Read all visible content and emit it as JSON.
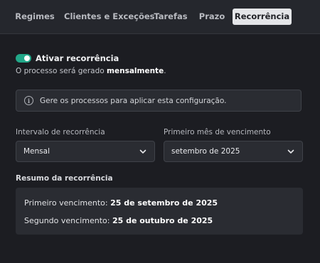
{
  "tabs": [
    {
      "label": "Regimes",
      "active": false
    },
    {
      "label": "Clientes e Exceções",
      "active": false
    },
    {
      "label": "Tarefas",
      "active": false
    },
    {
      "label": "Prazo",
      "active": false
    },
    {
      "label": "Recorrência",
      "active": true
    }
  ],
  "toggle": {
    "label": "Ativar recorrência",
    "on": true
  },
  "frequency_text": {
    "prefix": "O processo será gerado ",
    "value": "mensalmente",
    "suffix": "."
  },
  "info": {
    "text": "Gere os processos para aplicar esta configuração."
  },
  "fields": {
    "interval": {
      "label": "Intervalo de recorrência",
      "value": "Mensal"
    },
    "first_month": {
      "label": "Primeiro mês de vencimento",
      "value": "setembro de 2025"
    }
  },
  "summary": {
    "title": "Resumo da recorrência",
    "first": {
      "label": "Primeiro vencimento: ",
      "value": "25 de setembro de 2025"
    },
    "second": {
      "label": "Segundo vencimento: ",
      "value": "25 de outubro de 2025"
    }
  },
  "colors": {
    "background": "#1c1d22",
    "tab_bar": "#25272d",
    "active_tab": "#e4e5e8",
    "toggle_on": "#22a889",
    "panel": "#2a2c32"
  },
  "icons": {
    "info": "info-circle-icon",
    "dropdown": "chevron-down-icon"
  }
}
